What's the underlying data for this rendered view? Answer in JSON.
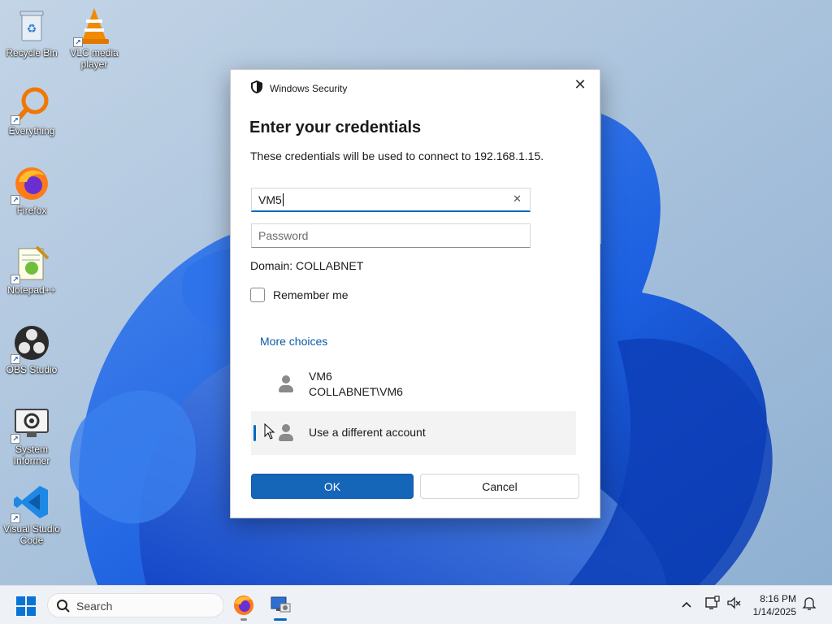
{
  "desktop": {
    "icons": [
      {
        "label": "Recycle Bin",
        "icon": "recycle-bin-icon"
      },
      {
        "label": "VLC media player",
        "icon": "vlc-icon"
      },
      {
        "label": "Everything",
        "icon": "everything-search-icon"
      },
      {
        "label": "Firefox",
        "icon": "firefox-icon"
      },
      {
        "label": "Notepad++",
        "icon": "notepad-plus-plus-icon"
      },
      {
        "label": "OBS Studio",
        "icon": "obs-studio-icon"
      },
      {
        "label": "System Informer",
        "icon": "system-informer-icon"
      },
      {
        "label": "Visual Studio Code",
        "icon": "vscode-icon"
      }
    ]
  },
  "dialog": {
    "app_title": "Windows Security",
    "close_glyph": "✕",
    "heading": "Enter your credentials",
    "description": "These credentials will be used to connect to 192.168.1.15.",
    "username": {
      "value": "VM5",
      "clear_glyph": "✕"
    },
    "password": {
      "placeholder": "Password",
      "value": ""
    },
    "domain": "Domain: COLLABNET",
    "remember_me": {
      "label": "Remember me",
      "checked": false
    },
    "more_choices": "More choices",
    "accounts": [
      {
        "line1": "VM6",
        "line2": "COLLABNET\\VM6"
      },
      {
        "line1": "Use a different account",
        "selected": true
      }
    ],
    "ok_label": "OK",
    "cancel_label": "Cancel"
  },
  "taskbar": {
    "search_placeholder": "Search",
    "time": "8:16 PM",
    "date": "1/14/2025",
    "apps": [
      "firefox-icon",
      "remote-desktop-icon"
    ]
  },
  "colors": {
    "accent": "#1565b8",
    "link": "#0a5aa8",
    "wallpaper_bg": "#9db7d3",
    "bloom_blue": "#1b5fe0"
  }
}
